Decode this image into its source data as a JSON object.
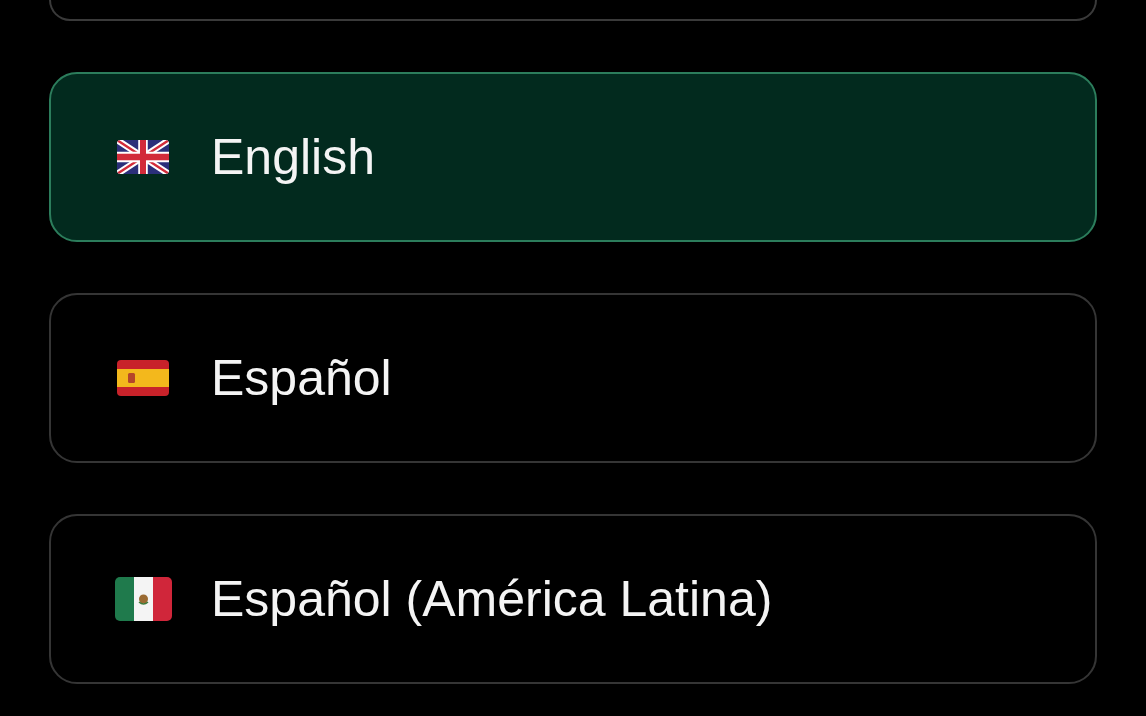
{
  "languages": [
    {
      "label": "English",
      "selected": true
    },
    {
      "label": "Español",
      "selected": false
    },
    {
      "label": "Español (América Latina)",
      "selected": false
    }
  ]
}
